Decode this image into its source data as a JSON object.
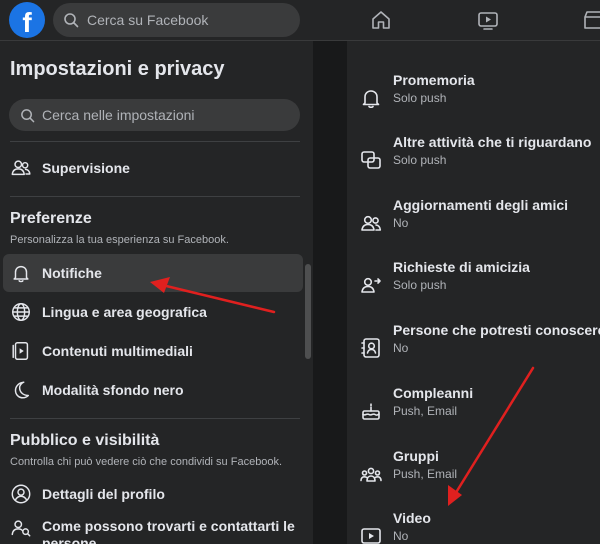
{
  "topbar": {
    "logo_letter": "f",
    "search_placeholder": "Cerca su Facebook"
  },
  "left": {
    "title": "Impostazioni e privacy",
    "search_placeholder": "Cerca nelle impostazioni",
    "supervision": "Supervisione",
    "preferences": {
      "title": "Preferenze",
      "subtitle": "Personalizza la tua esperienza su Facebook.",
      "items": [
        "Notifiche",
        "Lingua e area geografica",
        "Contenuti multimediali",
        "Modalità sfondo nero"
      ]
    },
    "public": {
      "title": "Pubblico e visibilità",
      "subtitle": "Controlla chi può vedere ciò che condividi su Facebook.",
      "items": [
        "Dettagli del profilo",
        "Come possono trovarti e contattarti le persone"
      ]
    }
  },
  "right": {
    "rows": [
      {
        "title": "Promemoria",
        "sub": "Solo push"
      },
      {
        "title": "Altre attività che ti riguardano",
        "sub": "Solo push"
      },
      {
        "title": "Aggiornamenti degli amici",
        "sub": "No"
      },
      {
        "title": "Richieste di amicizia",
        "sub": "Solo push"
      },
      {
        "title": "Persone che potresti conoscere",
        "sub": "No"
      },
      {
        "title": "Compleanni",
        "sub": "Push, Email"
      },
      {
        "title": "Gruppi",
        "sub": "Push, Email"
      },
      {
        "title": "Video",
        "sub": "No"
      }
    ]
  },
  "colors": {
    "background": "#18191a",
    "panel": "#242526",
    "accent_blue": "#1b74e4",
    "annotation_arrow": "#e0201f"
  }
}
